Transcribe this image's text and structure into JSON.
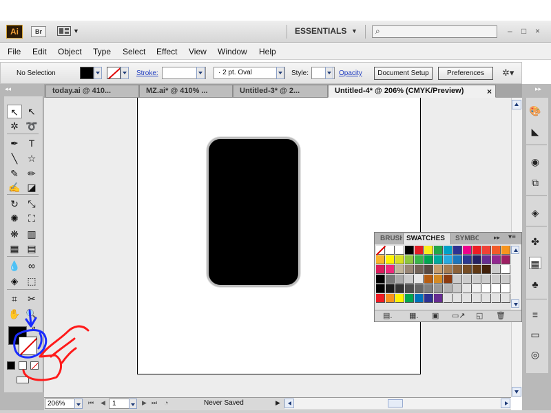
{
  "app": {
    "logo": "Ai",
    "bridge_button": "Br",
    "workspace": "ESSENTIALS",
    "search_placeholder": "",
    "window_controls": [
      "–",
      "□",
      "×"
    ]
  },
  "menu": [
    "File",
    "Edit",
    "Object",
    "Type",
    "Select",
    "Effect",
    "View",
    "Window",
    "Help"
  ],
  "control_bar": {
    "selection_status": "No Selection",
    "stroke_label": "Stroke:",
    "stroke_weight": "",
    "brush_definition": "·  2 pt. Oval",
    "style_label": "Style:",
    "opacity_label": "Opacity",
    "document_setup": "Document Setup",
    "preferences": "Preferences",
    "colors": {
      "fill": "#000000",
      "stroke": "none"
    }
  },
  "tabs": [
    {
      "label": "today.ai @ 410...",
      "active": false
    },
    {
      "label": "MZ.ai* @ 410% ...",
      "active": false
    },
    {
      "label": "Untitled-3* @ 2...",
      "active": false
    },
    {
      "label": "Untitled-4* @ 206% (CMYK/Preview)",
      "active": true,
      "close": "×"
    }
  ],
  "tools": [
    {
      "name": "selection-tool-icon",
      "glyph": "↖"
    },
    {
      "name": "direct-selection-tool-icon",
      "glyph": "↖"
    },
    {
      "name": "magic-wand-tool-icon",
      "glyph": "✲"
    },
    {
      "name": "lasso-tool-icon",
      "glyph": "➰"
    },
    {
      "name": "pen-tool-icon",
      "glyph": "✒"
    },
    {
      "name": "type-tool-icon",
      "glyph": "T"
    },
    {
      "name": "line-tool-icon",
      "glyph": "╲"
    },
    {
      "name": "star-tool-icon",
      "glyph": "☆"
    },
    {
      "name": "paintbrush-tool-icon",
      "glyph": "✎"
    },
    {
      "name": "pencil-tool-icon",
      "glyph": "✏"
    },
    {
      "name": "blob-brush-tool-icon",
      "glyph": "✍"
    },
    {
      "name": "eraser-tool-icon",
      "glyph": "◪"
    },
    {
      "name": "rotate-tool-icon",
      "glyph": "↻"
    },
    {
      "name": "scale-tool-icon",
      "glyph": "⤡"
    },
    {
      "name": "warp-tool-icon",
      "glyph": "✺"
    },
    {
      "name": "free-transform-tool-icon",
      "glyph": "⛶"
    },
    {
      "name": "symbol-sprayer-tool-icon",
      "glyph": "❋"
    },
    {
      "name": "column-graph-tool-icon",
      "glyph": "▥"
    },
    {
      "name": "mesh-tool-icon",
      "glyph": "▦"
    },
    {
      "name": "gradient-tool-icon",
      "glyph": "▤"
    },
    {
      "name": "eyedropper-tool-icon",
      "glyph": "💧"
    },
    {
      "name": "blend-tool-icon",
      "glyph": "∞"
    },
    {
      "name": "live-paint-bucket-tool-icon",
      "glyph": "◈"
    },
    {
      "name": "live-paint-selection-tool-icon",
      "glyph": "⬚"
    },
    {
      "name": "crop-area-tool-icon",
      "glyph": "⌗"
    },
    {
      "name": "slice-tool-icon",
      "glyph": "✂"
    },
    {
      "name": "hand-tool-icon",
      "glyph": "✋"
    },
    {
      "name": "zoom-tool-icon",
      "glyph": "🔍"
    }
  ],
  "toolbar_colors": {
    "fill": "#000000",
    "stroke": "none"
  },
  "panel": {
    "tabs": [
      "BRUSHES",
      "SWATCHES",
      "SYMBOLS"
    ],
    "active_tab": "SWATCHES"
  },
  "swatch_rows": [
    [
      "none",
      "#ffffff",
      "#ffffff",
      "#000000",
      "#e11e26",
      "#f9ed1d",
      "#23a64a",
      "#00a0c6",
      "#2e3192",
      "#ec008c",
      "#ed1c24",
      "#ef4136",
      "#f15a29",
      "#f7941d"
    ],
    [
      "#f8b62b",
      "#fff200",
      "#d7df23",
      "#8dc63f",
      "#39b54a",
      "#00a651",
      "#00a99d",
      "#27aae1",
      "#1c75bc",
      "#2b3990",
      "#262262",
      "#662d91",
      "#92278f",
      "#9e1f63"
    ],
    [
      "#da1c5c",
      "#ee2a7b",
      "#c2b59b",
      "#998675",
      "#736357",
      "#594a42",
      "#c69c6d",
      "#a67c52",
      "#8c6239",
      "#754c24",
      "#603813",
      "#42210b",
      "#cccccc",
      "#ffffff"
    ],
    [
      "#000000",
      "#777777",
      "#aaaaaa",
      "#cccccc",
      "#e8e8e8",
      "#b55d12",
      "#d48a24",
      "#8b3a0f",
      "#cccccc",
      "#cccccc",
      "#cccccc",
      "#cccccc",
      "#cccccc",
      "#cccccc"
    ],
    [
      "#000000",
      "#1a1a1a",
      "#333333",
      "#4d4d4d",
      "#666666",
      "#808080",
      "#999999",
      "#b3b3b3",
      "#cccccc",
      "#e6e6e6",
      "#f2f2f2",
      "#ffffff",
      "#ffffff",
      "#ffffff"
    ],
    [
      "#ed1c24",
      "#f7941d",
      "#fff200",
      "#00a651",
      "#0072bc",
      "#2e3192",
      "#662d91",
      "#e3e3e3",
      "#e3e3e3",
      "#e3e3e3",
      "#e3e3e3",
      "#e3e3e3",
      "#e3e3e3",
      "#e3e3e3"
    ]
  ],
  "status": {
    "zoom": "206%",
    "page": "1",
    "text": "Never Saved"
  },
  "annotations": {
    "blue": "#1a2cff",
    "red": "#ff1a1a"
  },
  "artwork": {
    "shape": "rounded-rectangle",
    "fill": "#000000",
    "stroke": "#bdbdbd"
  }
}
